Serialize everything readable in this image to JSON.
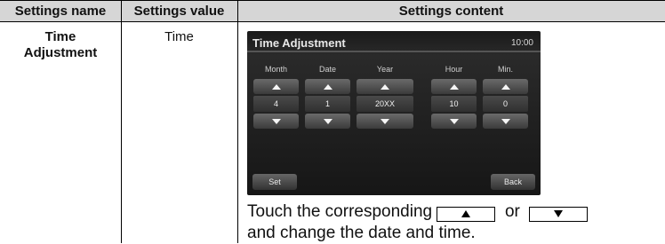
{
  "table": {
    "headers": {
      "name": "Settings name",
      "value": "Settings value",
      "content": "Settings content"
    },
    "row": {
      "name_line1": "Time",
      "name_line2": "Adjustment",
      "value": "Time"
    }
  },
  "screen": {
    "title": "Time Adjustment",
    "clock": "10:00",
    "columns": [
      {
        "label": "Month",
        "value": "4"
      },
      {
        "label": "Date",
        "value": "1"
      },
      {
        "label": "Year",
        "value": "20XX"
      },
      {
        "label": "Hour",
        "value": "10"
      },
      {
        "label": "Min.",
        "value": "0"
      }
    ],
    "set_label": "Set",
    "back_label": "Back"
  },
  "description": {
    "part1": "Touch the corresponding",
    "or": "or",
    "part2": "and change the date and time.",
    "up_icon": "up-triangle-icon",
    "down_icon": "down-triangle-icon"
  }
}
